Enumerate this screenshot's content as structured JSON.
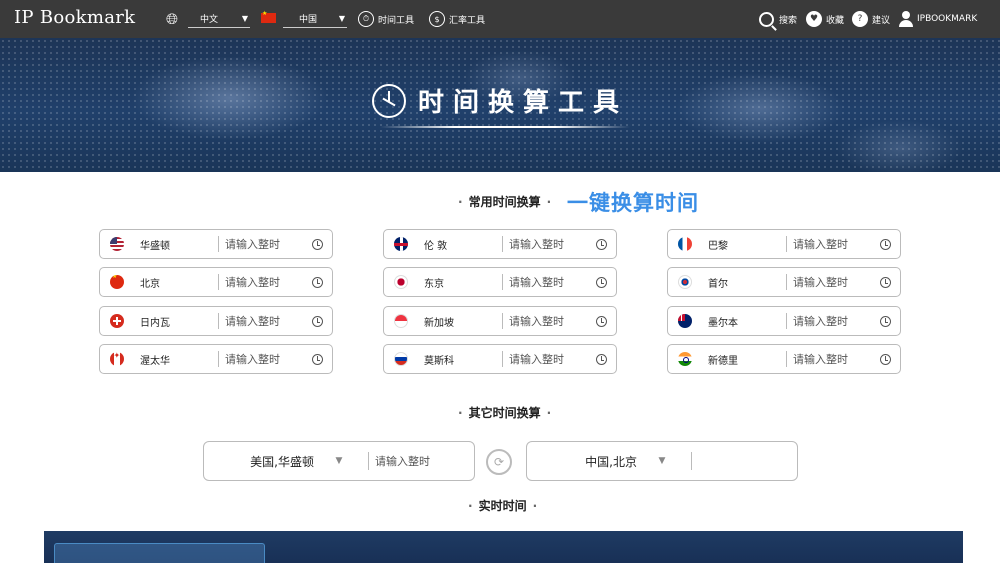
{
  "header": {
    "logo": "IP Bookmark",
    "language": "中文",
    "country": "中国",
    "nav_time": "时间工具",
    "nav_rate": "汇率工具",
    "nav_search": "搜索",
    "nav_fav": "收藏",
    "nav_suggest": "建议",
    "nav_user": "IPBOOKMARK"
  },
  "banner": {
    "title": "时间换算工具"
  },
  "common": {
    "title": "常用时间换算",
    "slogan": "一键换算时间",
    "placeholder": "请输入整时",
    "cities": [
      {
        "name": "华盛顿",
        "flag": "us"
      },
      {
        "name": "伦 敦",
        "flag": "uk"
      },
      {
        "name": "巴黎",
        "flag": "fr"
      },
      {
        "name": "北京",
        "flag": "cn"
      },
      {
        "name": "东京",
        "flag": "jp"
      },
      {
        "name": "首尔",
        "flag": "kr"
      },
      {
        "name": "日内瓦",
        "flag": "ch"
      },
      {
        "name": "新加坡",
        "flag": "sg"
      },
      {
        "name": "墨尔本",
        "flag": "au"
      },
      {
        "name": "渥太华",
        "flag": "ca"
      },
      {
        "name": "莫斯科",
        "flag": "ru"
      },
      {
        "name": "新德里",
        "flag": "in"
      }
    ]
  },
  "other": {
    "title": "其它时间换算",
    "from_location": "美国,华盛顿",
    "from_placeholder": "请输入整时",
    "to_location": "中国,北京"
  },
  "realtime": {
    "title": "实时时间"
  }
}
